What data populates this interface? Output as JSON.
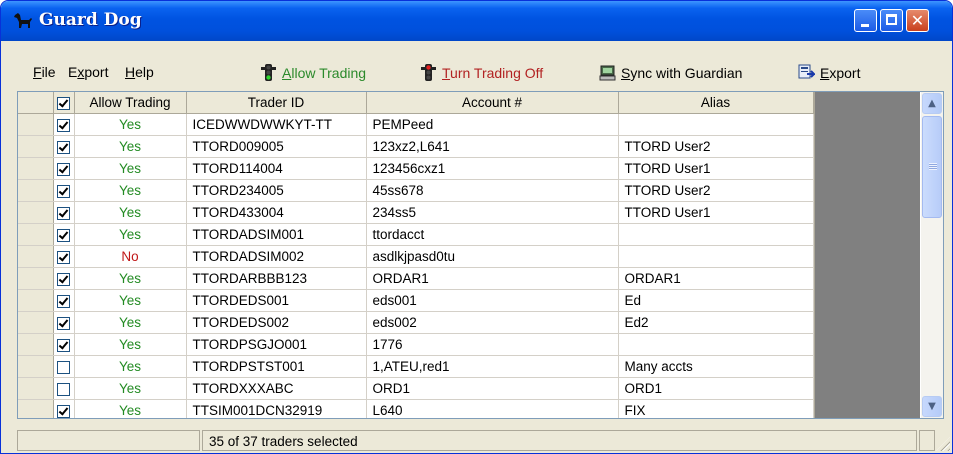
{
  "window": {
    "title": "Guard Dog",
    "title_icon": "dog-icon"
  },
  "menu": {
    "file": {
      "ul": "F",
      "rest": "ile"
    },
    "export": {
      "pre": "E",
      "ul": "x",
      "rest": "port"
    },
    "help": {
      "ul": "H",
      "rest": "elp"
    }
  },
  "toolbar": {
    "allow_trading": {
      "ul": "A",
      "rest": "llow Trading",
      "icon": "traffic-light-green-icon",
      "color": "#2b8a2b"
    },
    "turn_off": {
      "ul": "T",
      "rest": "urn Trading Off",
      "icon": "traffic-light-red-icon",
      "color": "#b22222"
    },
    "sync": {
      "ul": "S",
      "rest": "ync with Guardian",
      "icon": "sync-computer-icon"
    },
    "export": {
      "ul": "E",
      "rest": "xport",
      "icon": "export-icon"
    }
  },
  "grid": {
    "columns": [
      "Allow Trading",
      "Trader ID",
      "Account #",
      "Alias"
    ],
    "header_checkbox_checked": true,
    "rows": [
      {
        "checked": true,
        "allow": "Yes",
        "trader": "ICEDWWDWWKYT-TT",
        "account": "PEMPeed",
        "alias": ""
      },
      {
        "checked": true,
        "allow": "Yes",
        "trader": "TTORD009005",
        "account": "123xz2,L641",
        "alias": "TTORD User2"
      },
      {
        "checked": true,
        "allow": "Yes",
        "trader": "TTORD114004",
        "account": "123456cxz1",
        "alias": "TTORD User1"
      },
      {
        "checked": true,
        "allow": "Yes",
        "trader": "TTORD234005",
        "account": "45ss678",
        "alias": "TTORD User2"
      },
      {
        "checked": true,
        "allow": "Yes",
        "trader": "TTORD433004",
        "account": "234ss5",
        "alias": "TTORD User1"
      },
      {
        "checked": true,
        "allow": "Yes",
        "trader": "TTORDADSIM001",
        "account": "ttordacct",
        "alias": ""
      },
      {
        "checked": true,
        "allow": "No",
        "trader": "TTORDADSIM002",
        "account": "asdlkjpasd0tu",
        "alias": ""
      },
      {
        "checked": true,
        "allow": "Yes",
        "trader": "TTORDARBBB123",
        "account": "ORDAR1",
        "alias": "ORDAR1"
      },
      {
        "checked": true,
        "allow": "Yes",
        "trader": "TTORDEDS001",
        "account": "eds001",
        "alias": "Ed"
      },
      {
        "checked": true,
        "allow": "Yes",
        "trader": "TTORDEDS002",
        "account": "eds002",
        "alias": "Ed2"
      },
      {
        "checked": true,
        "allow": "Yes",
        "trader": "TTORDPSGJO001",
        "account": "1776",
        "alias": ""
      },
      {
        "checked": false,
        "allow": "Yes",
        "trader": "TTORDPSTST001",
        "account": "1,ATEU,red1",
        "alias": "Many accts"
      },
      {
        "checked": false,
        "allow": "Yes",
        "trader": "TTORDXXXABC",
        "account": "ORD1",
        "alias": "ORD1"
      },
      {
        "checked": true,
        "allow": "Yes",
        "trader": "TTSIM001DCN32919",
        "account": "L640",
        "alias": "FIX"
      }
    ]
  },
  "status": {
    "text": "35 of 37 traders selected"
  },
  "colors": {
    "yes": "#238b23",
    "no": "#c01818",
    "title_bar": "#0053e1"
  }
}
